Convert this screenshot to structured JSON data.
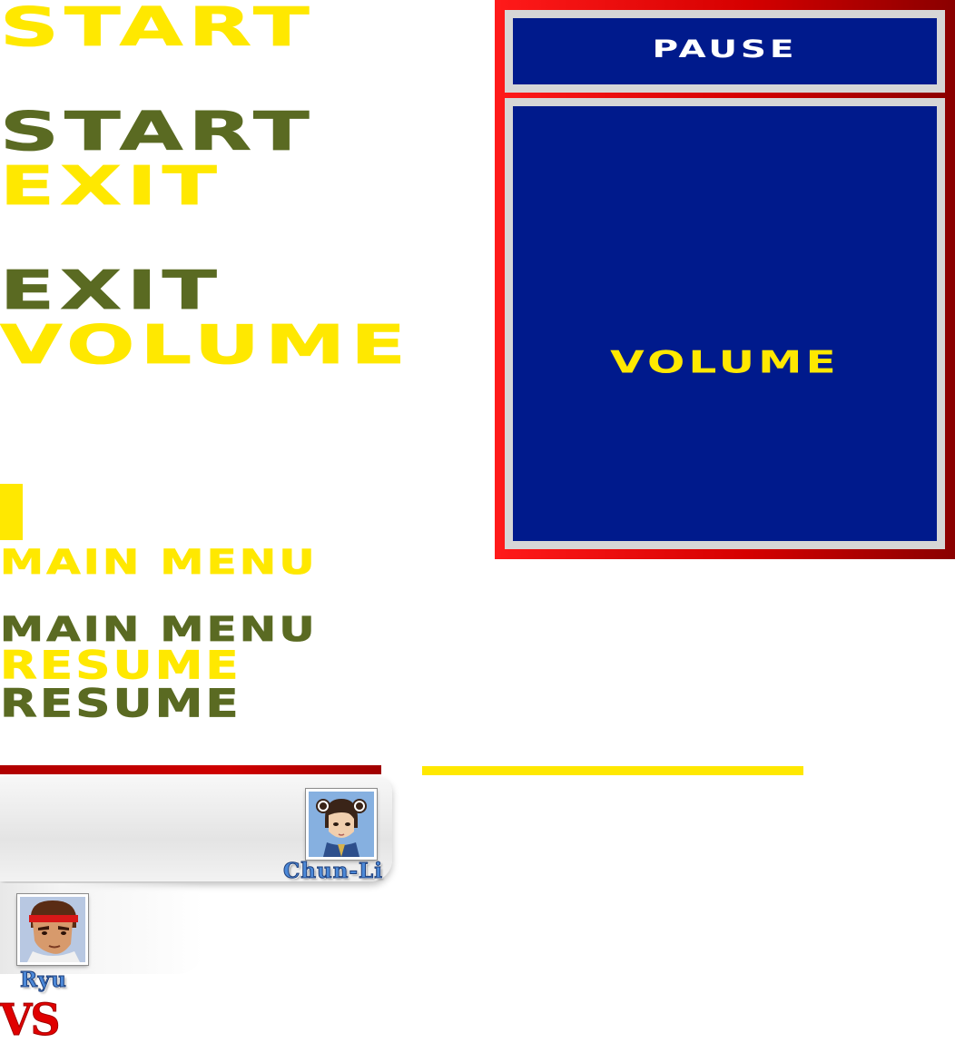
{
  "menu_labels": {
    "start": "START",
    "exit": "EXIT",
    "volume": "VOLUME",
    "main_menu": "MAIN MENU",
    "resume": "RESUME"
  },
  "volume_level": 0.05,
  "pause_panel": {
    "title": "PAUSE",
    "content": "VOLUME"
  },
  "players": {
    "player1": {
      "name": "Chun-Li",
      "portrait_icon": "chun-li-portrait"
    },
    "player2": {
      "name": "Ryu",
      "portrait_icon": "ryu-portrait"
    }
  },
  "health": {
    "player1_fill": 1.0,
    "player2_fill": 1.0
  },
  "vs_text": "VS",
  "colors": {
    "menu_yellow": "#ffe800",
    "menu_olive": "#5a6a22",
    "panel_red": "#e00000",
    "panel_blue": "#001a8c",
    "health_red": "#b00000",
    "health_yellow": "#ffe800",
    "name_blue": "#4c89d8"
  }
}
